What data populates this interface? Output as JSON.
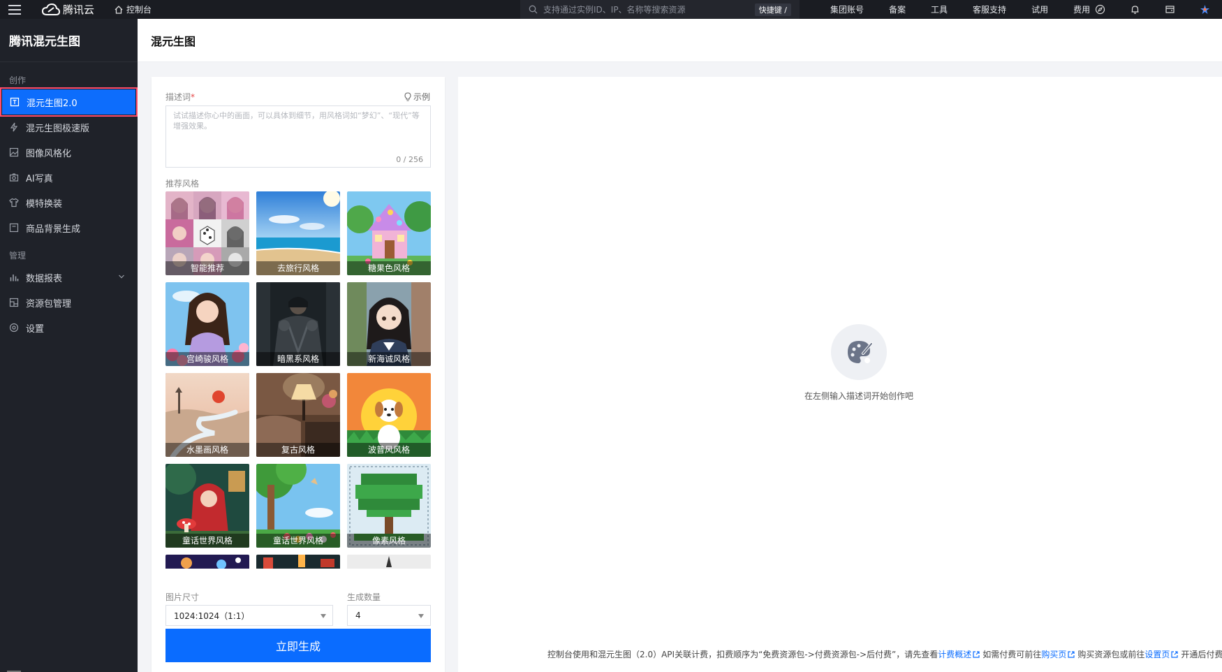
{
  "topbar": {
    "brand": "腾讯云",
    "console": "控制台",
    "search_placeholder": "支持通过实例ID、IP、名称等搜索资源",
    "shortcut": "快捷键 /",
    "links": [
      "集团账号",
      "备案",
      "工具",
      "客服支持",
      "试用",
      "费用"
    ]
  },
  "sidebar": {
    "title": "腾讯混元生图",
    "group_create": "创作",
    "group_manage": "管理",
    "create_items": [
      {
        "label": "混元生图2.0",
        "icon": "image-frame-icon"
      },
      {
        "label": "混元生图极速版",
        "icon": "lightning-icon"
      },
      {
        "label": "图像风格化",
        "icon": "picture-icon"
      },
      {
        "label": "AI写真",
        "icon": "camera-icon"
      },
      {
        "label": "模特换装",
        "icon": "shirt-icon"
      },
      {
        "label": "商品背景生成",
        "icon": "product-icon"
      }
    ],
    "manage_items": [
      {
        "label": "数据报表",
        "icon": "bar-chart-icon"
      },
      {
        "label": "资源包管理",
        "icon": "package-icon"
      },
      {
        "label": "设置",
        "icon": "settings-icon"
      }
    ]
  },
  "main": {
    "title": "混元生图",
    "prompt": {
      "label": "描述词",
      "required_mark": "*",
      "example": "示例",
      "placeholder": "试试描述你心中的画面，可以具体到细节，用风格词如“梦幻”、“现代”等增强效果。",
      "counter": "0 / 256"
    },
    "styles_label": "推荐风格",
    "styles": [
      {
        "label": "智能推荐"
      },
      {
        "label": "去旅行风格"
      },
      {
        "label": "糖果色风格"
      },
      {
        "label": "宫崎骏风格"
      },
      {
        "label": "暗黑系风格"
      },
      {
        "label": "新海诚风格"
      },
      {
        "label": "水墨画风格",
        "selected": true
      },
      {
        "label": "复古风格"
      },
      {
        "label": "波普风风格"
      },
      {
        "label": "童话世界风格"
      },
      {
        "label": "童话世界风格"
      },
      {
        "label": "像素风格"
      }
    ],
    "size": {
      "label": "图片尺寸",
      "value": "1024:1024（1:1）"
    },
    "count": {
      "label": "生成数量",
      "value": "4"
    },
    "generate_button": "立即生成",
    "empty_text": "在左侧输入描述词开始创作吧",
    "footnote": {
      "t1": "控制台使用和混元生图（2.0）API关联计费，扣费顺序为“免费资源包->付费资源包->后付费”，请先查看",
      "l1": "计费概述",
      "t2": "如需付费可前往",
      "l2": "购买页",
      "t3": "购买资源包或前往",
      "l3": "设置页",
      "t4": "开通后付费。"
    }
  },
  "colors": {
    "accent": "#0a6cff",
    "sidebar_bg": "#1f2229",
    "topbar_bg": "#1a1c22",
    "highlight": "#ff4d6d"
  }
}
